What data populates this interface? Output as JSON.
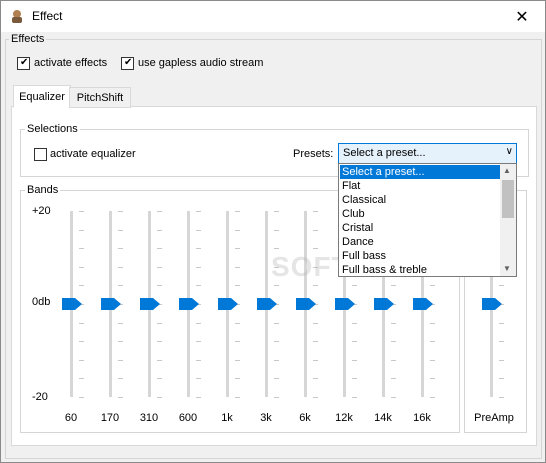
{
  "window": {
    "title": "Effect",
    "close_glyph": "✕"
  },
  "effects_group": {
    "label": "Effects",
    "activate_effects": {
      "label": "activate effects",
      "checked": true
    },
    "gapless": {
      "label": "use gapless audio stream",
      "checked": true
    }
  },
  "tabs": [
    {
      "label": "Equalizer",
      "active": true
    },
    {
      "label": "PitchShift",
      "active": false
    }
  ],
  "selections": {
    "label": "Selections",
    "activate_equalizer": {
      "label": "activate equalizer",
      "checked": false
    },
    "presets_label": "Presets:",
    "preset_value": "Select a preset...",
    "dropdown_items": [
      "Select a preset...",
      "Flat",
      "Classical",
      "Club",
      "Cristal",
      "Dance",
      "Full bass",
      "Full bass & treble"
    ]
  },
  "bands": {
    "label": "Bands",
    "top": "+20",
    "mid": "0db",
    "bottom": "-20",
    "frequencies": [
      "60",
      "170",
      "310",
      "600",
      "1k",
      "3k",
      "6k",
      "12k",
      "14k",
      "16k"
    ],
    "preamp": "PreAmp",
    "levels_db": [
      0,
      0,
      0,
      0,
      0,
      0,
      0,
      0,
      0,
      0
    ],
    "preamp_db": 0
  },
  "watermark": "SOFTPEDIA",
  "colors": {
    "accent": "#0078d7",
    "selection_bg": "#e5f1fb"
  }
}
